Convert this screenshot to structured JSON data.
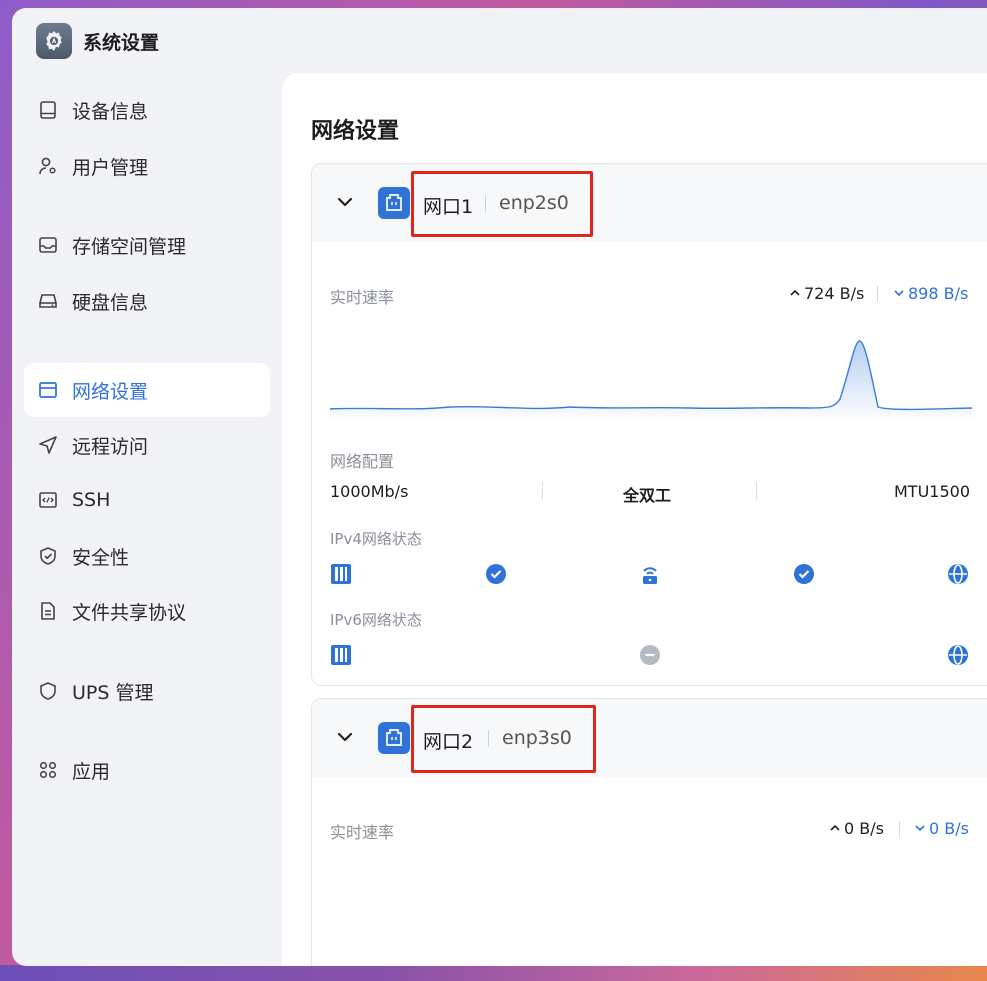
{
  "app": {
    "title": "系统设置"
  },
  "sidebar": {
    "items": [
      {
        "label": "设备信息",
        "icon": "device-icon"
      },
      {
        "label": "用户管理",
        "icon": "user-gear-icon"
      },
      {
        "label": "存储空间管理",
        "icon": "storage-icon"
      },
      {
        "label": "硬盘信息",
        "icon": "disk-icon"
      },
      {
        "label": "网络设置",
        "icon": "network-icon",
        "active": true
      },
      {
        "label": "远程访问",
        "icon": "send-icon"
      },
      {
        "label": "SSH",
        "icon": "code-icon"
      },
      {
        "label": "安全性",
        "icon": "shield-check-icon"
      },
      {
        "label": "文件共享协议",
        "icon": "document-icon"
      },
      {
        "label": "UPS 管理",
        "icon": "shield-icon"
      },
      {
        "label": "应用",
        "icon": "apps-icon"
      }
    ]
  },
  "main": {
    "title": "网络设置",
    "ports": [
      {
        "name": "网口1",
        "device": "enp2s0",
        "speed_label": "实时速率",
        "upload": "724 B/s",
        "download": "898 B/s",
        "config_label": "网络配置",
        "link_speed": "1000Mb/s",
        "duplex": "全双工",
        "mtu": "MTU1500",
        "ipv4_label": "IPv4网络状态",
        "ipv6_label": "IPv6网络状态",
        "ipv4_status": [
          "ok",
          "ok"
        ],
        "ipv6_status": [
          "pending"
        ]
      },
      {
        "name": "网口2",
        "device": "enp3s0",
        "speed_label": "实时速率",
        "upload": "0 B/s",
        "download": "0 B/s"
      }
    ]
  },
  "colors": {
    "accent": "#2f73d6",
    "highlight": "#e0251d",
    "sidebar_bg": "#f2f3f6"
  }
}
